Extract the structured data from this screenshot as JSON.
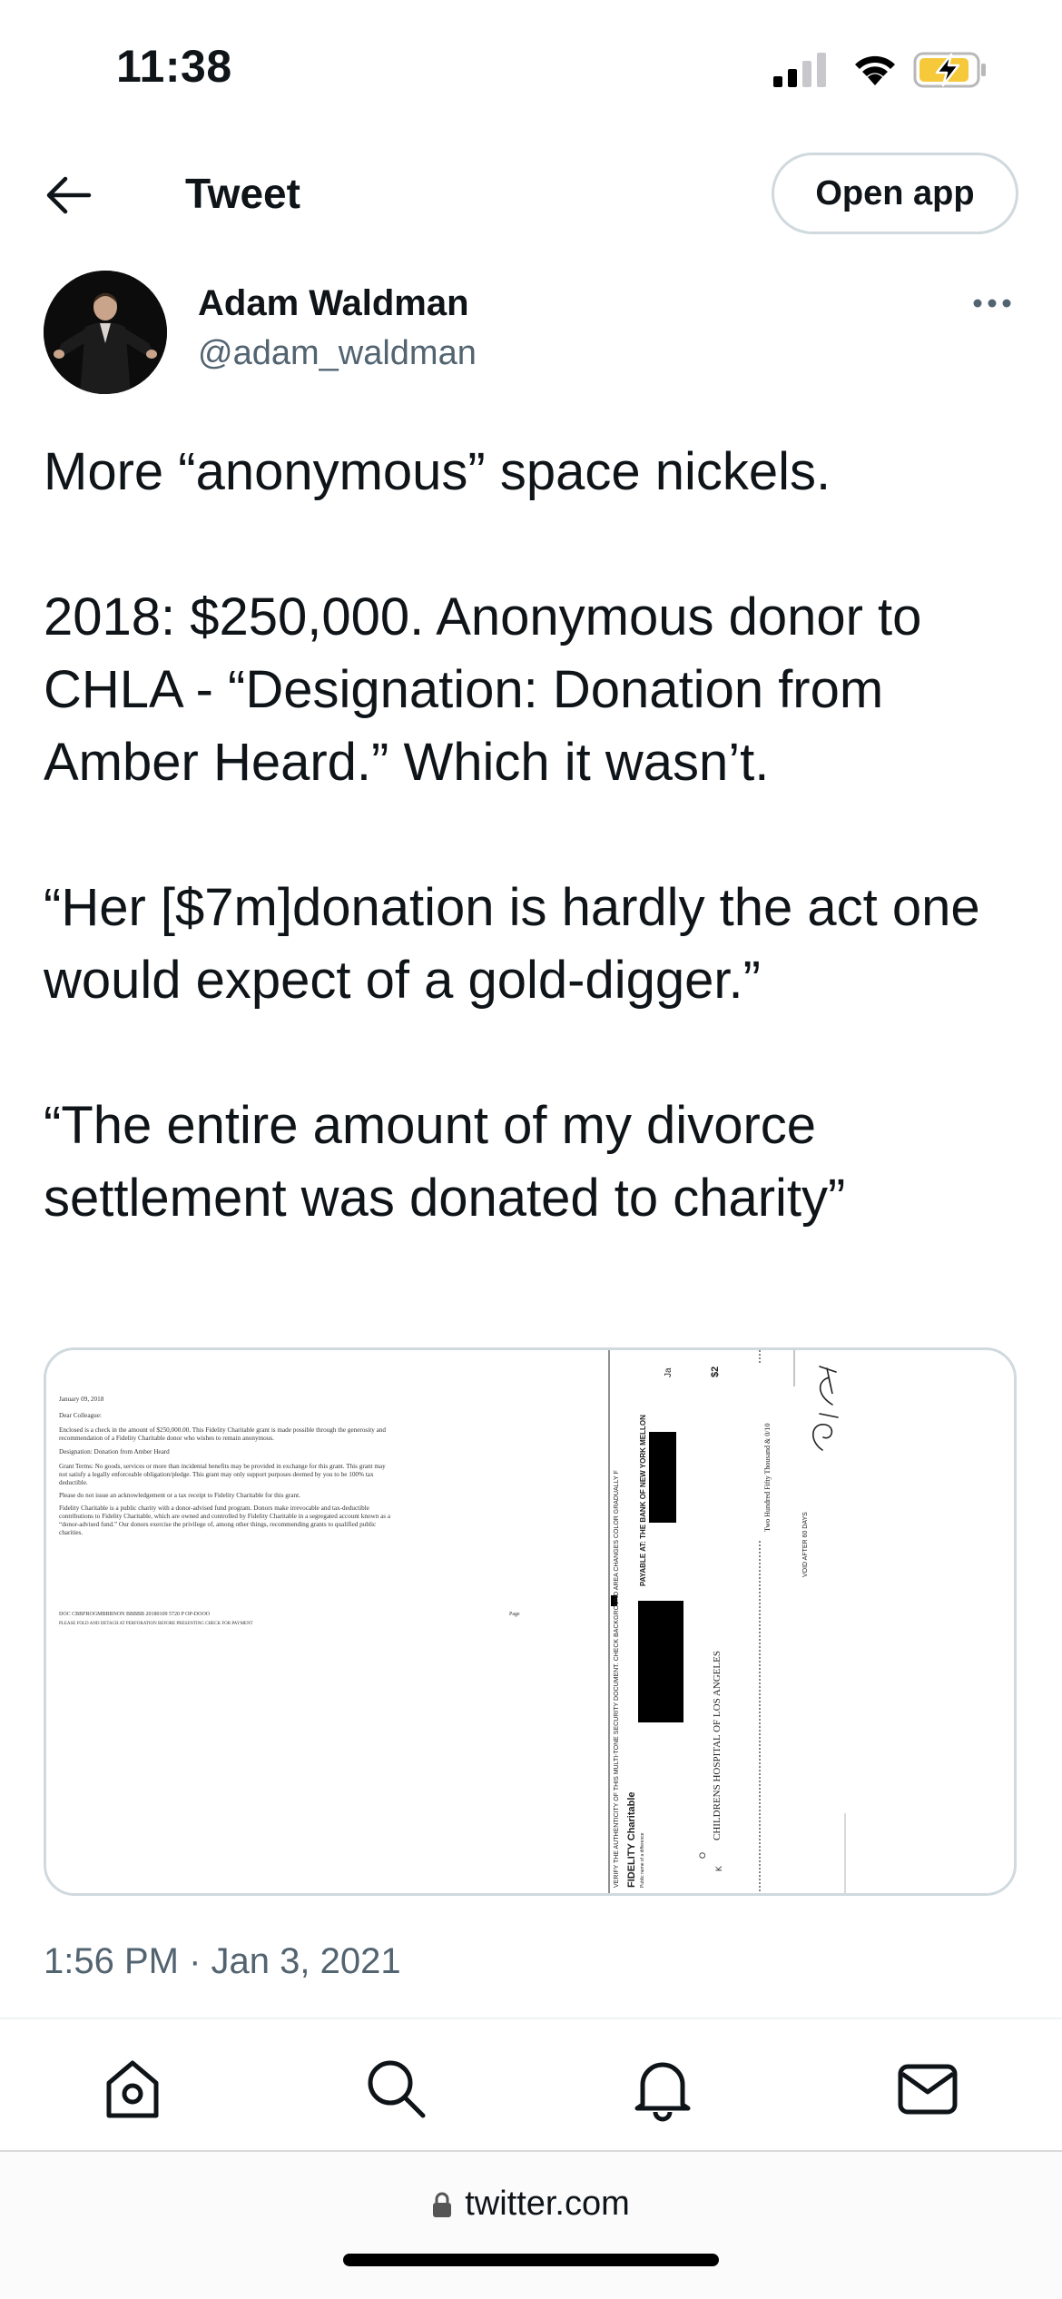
{
  "status_bar": {
    "time": "11:38",
    "icons": [
      "cellular-signal-icon",
      "wifi-icon",
      "battery-charging-icon"
    ],
    "battery_color": "#f5c93a"
  },
  "header": {
    "back_icon": "arrow-left-icon",
    "title": "Tweet",
    "open_app_label": "Open app"
  },
  "tweet": {
    "author": {
      "name": "Adam Waldman",
      "handle": "@adam_waldman"
    },
    "more_icon": "ellipsis-icon",
    "paragraphs": [
      "More “anonymous” space nickels.",
      "2018: $250,000. Anonymous donor to CHLA - “Designation: Donation from Amber Heard.” Which it wasn’t.",
      "“Her [$7m]donation is hardly the act one would expect of a gold-digger.”",
      "“The entire amount of my divorce settlement was donated to charity”"
    ],
    "media": {
      "letter_lines": [
        "January 09, 2018",
        "Dear Colleague:",
        "Enclosed is a check in the amount of $250,000.00. This Fidelity Charitable grant is made possible through the generosity and",
        "recommendation of a Fidelity Charitable donor who wishes to remain anonymous.",
        "Designation: Donation from Amber Heard",
        "Grant Terms: No goods, services or more than incidental benefits may be provided in exchange for this grant. This grant may",
        "not satisfy a legally enforceable obligation/pledge. This grant may only support purposes deemed by you to be 100% tax",
        "deductible.",
        "Please do not issue an acknowledgement or a tax receipt to Fidelity Charitable for this grant.",
        "Fidelity Charitable is a public charity with a donor-advised fund program. Donors make irrevocable and tax-deductible",
        "contributions to Fidelity Charitable, which are owned and controlled by Fidelity Charitable in a segregated account known as a",
        "“donor-advised fund.” Our donors exercise the privilege of, among other things, recommending grants to qualified public",
        "charities."
      ],
      "letter_footer": "DOC CBBFROGMBBBNON BBBBB 20180109 5720 P OP-DOOO",
      "letter_footer_page": "Page",
      "letter_footer_note": "PLEASE FOLD AND DETACH AT PERFORATION BEFORE PRESENTING CHECK FOR PAYMENT",
      "check_texts": {
        "security": "VERIFY THE AUTHENTICITY OF THIS MULTI-TONE SECURITY DOCUMENT. CHECK BACKGROUND AREA CHANGES COLOR GRADUALLY F",
        "bank": "PAYABLE AT: THE BANK OF NEW YORK MELLON",
        "fidelity": "FIDELITY Charitable",
        "fidelity_sub": "Public name of a difference",
        "payee": "CHILDRENS HOSPITAL OF LOS ANGELES",
        "amount_words": "Two Hundred Fifty Thousand & 0/10",
        "void": "VOID AFTER 60 DAYS",
        "date": "Ja",
        "amount_sym": "$2",
        "initial_o": "O",
        "initial_k": "K"
      }
    },
    "timestamp": "1:56 PM · Jan 3, 2021"
  },
  "bottom_nav": {
    "items": [
      "home-icon",
      "search-icon",
      "notifications-icon",
      "messages-icon"
    ]
  },
  "browser": {
    "url": "twitter.com"
  }
}
